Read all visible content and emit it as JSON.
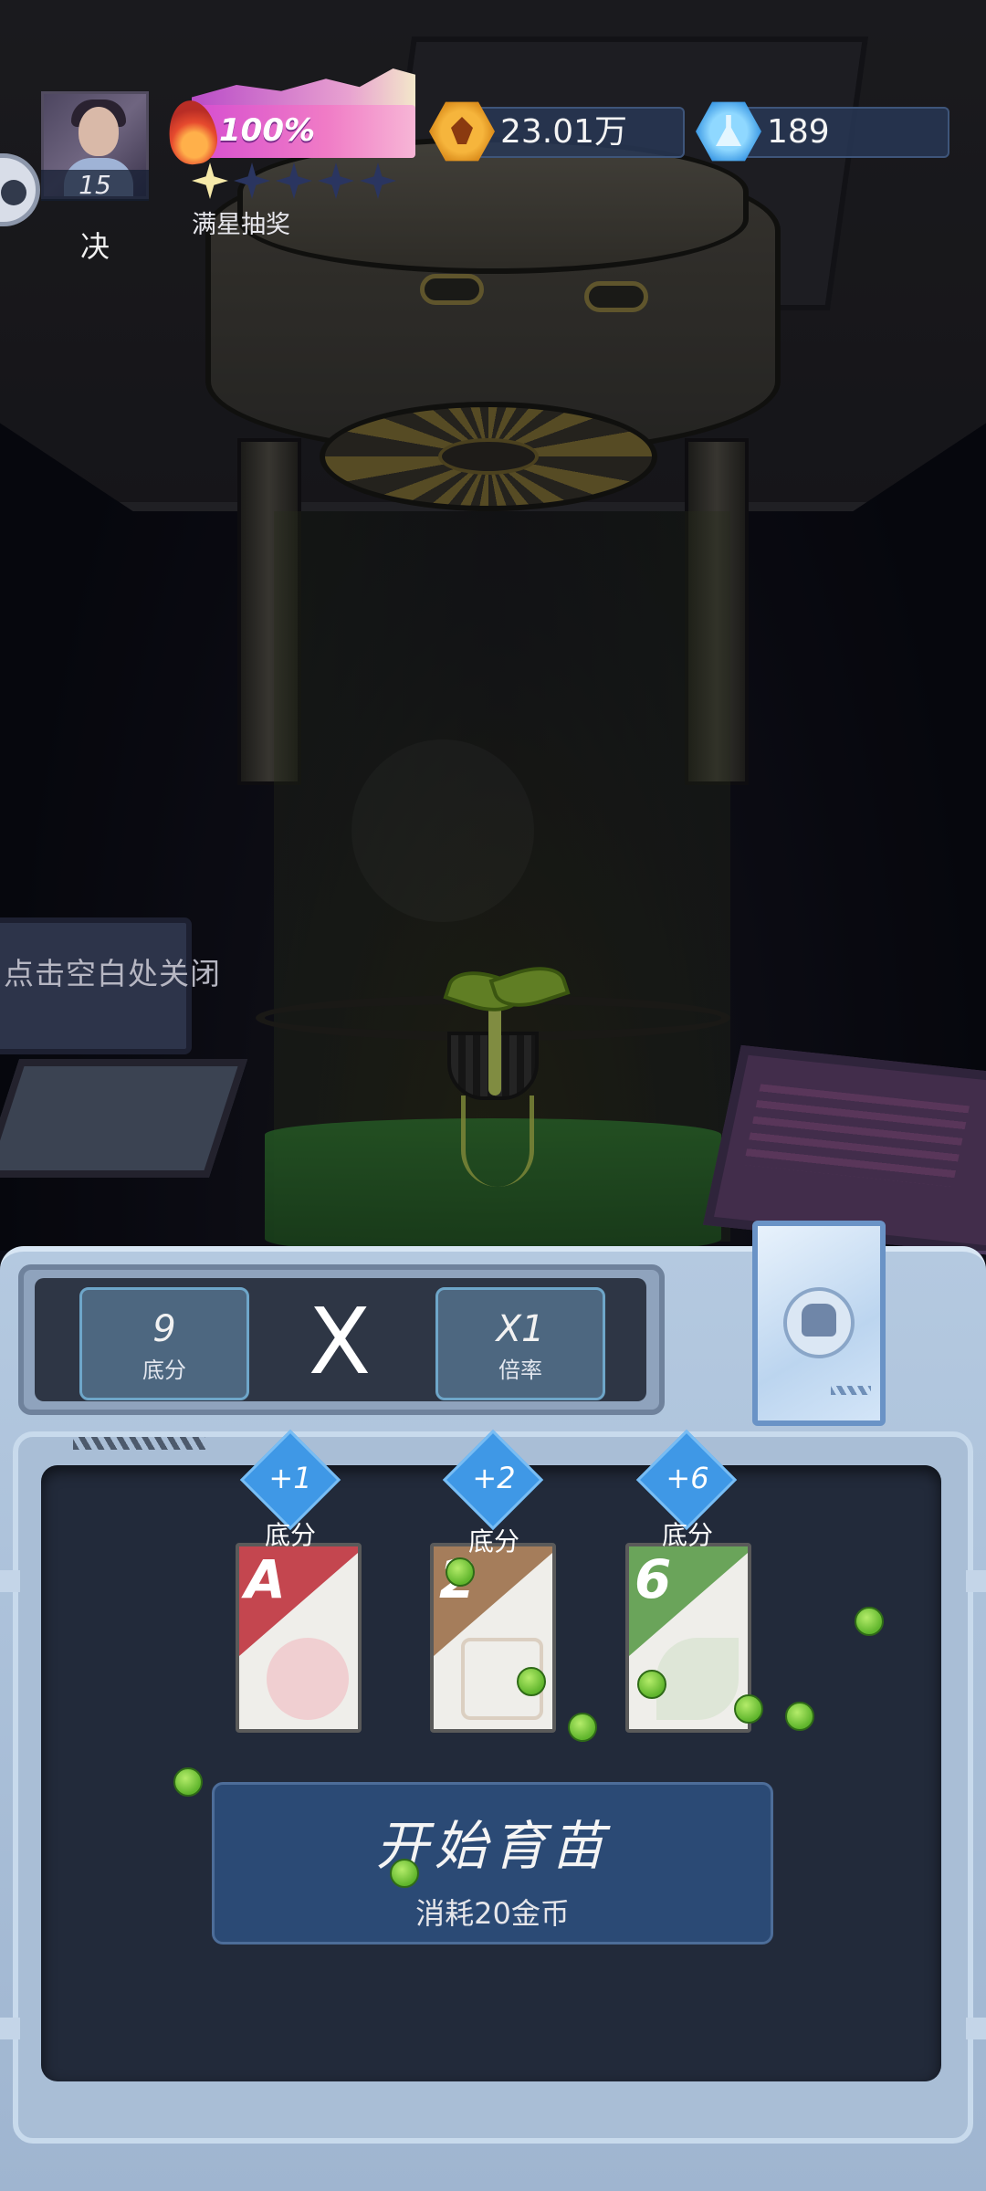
{
  "hud": {
    "level": "15",
    "player_name": "决",
    "energy_percent": "100%",
    "energy_fill": 1.0,
    "stars_lit": 1,
    "stars_total": 5,
    "star_lottery_label": "满星抽奖",
    "coins": "23.01万",
    "gems": "189"
  },
  "scene": {
    "close_hint": "点击空白处关闭"
  },
  "formula": {
    "base_value": "9",
    "base_label": "底分",
    "operator": "X",
    "multiplier_value": "X1",
    "multiplier_label": "倍率"
  },
  "cards": [
    {
      "rank": "A",
      "bonus": "+1",
      "bonus_label": "底分",
      "art": "apple-icon"
    },
    {
      "rank": "2",
      "bonus": "+2",
      "bonus_label": "底分",
      "art": "sprout-icon"
    },
    {
      "rank": "6",
      "bonus": "+6",
      "bonus_label": "底分",
      "art": "leaf-icon"
    }
  ],
  "start_button": {
    "title": "开始育苗",
    "cost": "消耗20金币"
  },
  "colors": {
    "energy": "#e36fcf",
    "coin": "#f0a830",
    "gem": "#3a9ae8",
    "panel": "#aec3dc",
    "button": "#2b4a75",
    "seed_dot": "#6fc43a"
  }
}
